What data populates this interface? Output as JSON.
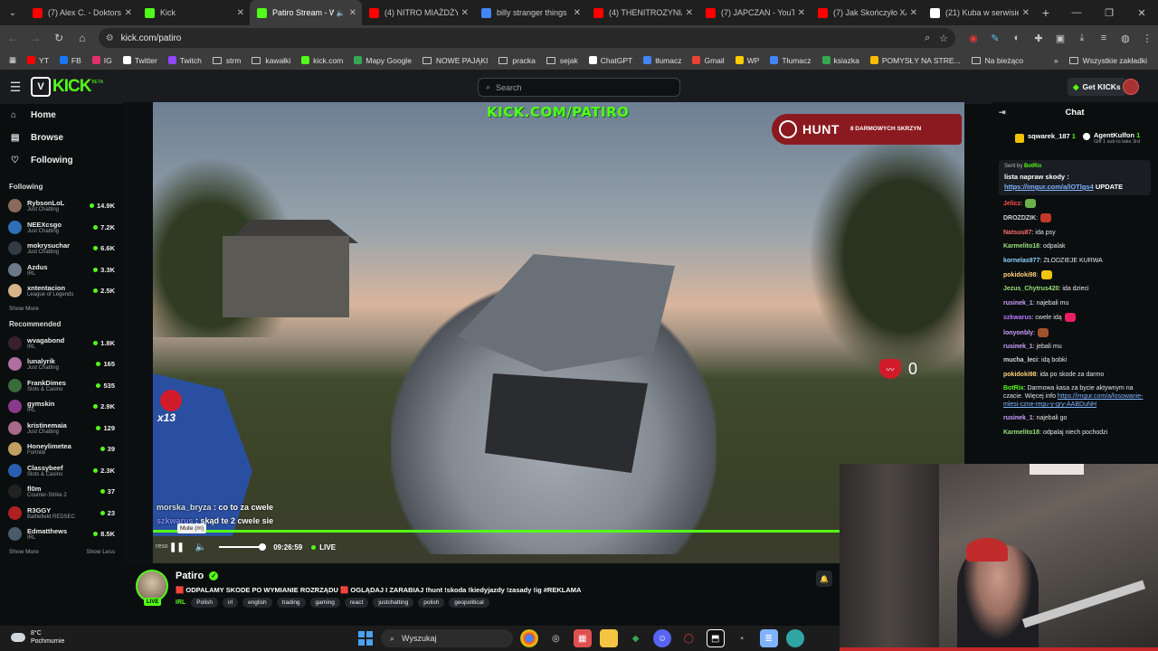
{
  "browser": {
    "tabs": [
      {
        "label": "(7) Alex C. - Doktorsp",
        "favicon_color": "#ff0000",
        "active": false
      },
      {
        "label": "Kick",
        "favicon_color": "#53fc18",
        "active": false
      },
      {
        "label": "Patiro Stream - W",
        "favicon_color": "#53fc18",
        "active": true
      },
      {
        "label": "(4) NITRO MIAŻDŻY",
        "favicon_color": "#ff0000",
        "active": false
      },
      {
        "label": "billy stranger things",
        "favicon_color": "#4285f4",
        "active": false
      },
      {
        "label": "(4) THENITROZYNIAK",
        "favicon_color": "#ff0000",
        "active": false
      },
      {
        "label": "(7) JAPCZAN - YouTu",
        "favicon_color": "#ff0000",
        "active": false
      },
      {
        "label": "(7) Jak Skończyło XA",
        "favicon_color": "#ff0000",
        "active": false
      },
      {
        "label": "(21) Kuba w serwisie",
        "favicon_color": "#ffffff",
        "active": false
      }
    ],
    "url": "kick.com/patiro",
    "bookmarks": [
      {
        "label": "YT",
        "color": "#ff0000"
      },
      {
        "label": "FB",
        "color": "#1877f2"
      },
      {
        "label": "IG",
        "color": "#e1306c"
      },
      {
        "label": "Twitter",
        "color": "#ffffff"
      },
      {
        "label": "Twitch",
        "color": "#9146ff"
      },
      {
        "label": "strm",
        "folder": true
      },
      {
        "label": "kawałki",
        "folder": true
      },
      {
        "label": "kick.com",
        "color": "#53fc18"
      },
      {
        "label": "Mapy Google",
        "color": "#34a853"
      },
      {
        "label": "NOWE PAJĄKI",
        "folder": true
      },
      {
        "label": "pracka",
        "folder": true
      },
      {
        "label": "sejak",
        "folder": true
      },
      {
        "label": "ChatGPT",
        "color": "#ffffff"
      },
      {
        "label": "tłumacz",
        "color": "#4285f4"
      },
      {
        "label": "Gmail",
        "color": "#ea4335"
      },
      {
        "label": "WP",
        "color": "#ffcc00"
      },
      {
        "label": "Tłumacz",
        "color": "#4285f4"
      },
      {
        "label": "ksiazka",
        "color": "#34a853"
      },
      {
        "label": "POMYSŁY NA STRE...",
        "color": "#fbbc05"
      },
      {
        "label": "Na bieżąco",
        "folder": true
      }
    ],
    "bookmarks_other": "Wszystkie zakładki"
  },
  "kick": {
    "logo": "KICK",
    "logo_beta": "BETA",
    "search_placeholder": "Search",
    "get_kicks": "Get KICKs"
  },
  "sidebar": {
    "nav": [
      {
        "label": "Home",
        "icon": "home-icon"
      },
      {
        "label": "Browse",
        "icon": "browse-icon"
      },
      {
        "label": "Following",
        "icon": "heart-icon"
      }
    ],
    "following_header": "Following",
    "following": [
      {
        "name": "RybsonLoL",
        "category": "Just Chatting",
        "viewers": "14.9K",
        "color": "#8a6a5a"
      },
      {
        "name": "NEEXcsgo",
        "category": "Just Chatting",
        "viewers": "7.2K",
        "color": "#2e6fb7"
      },
      {
        "name": "mokrysuchar",
        "category": "Just Chatting",
        "viewers": "6.6K",
        "color": "#333b44"
      },
      {
        "name": "Azdus",
        "category": "IRL",
        "viewers": "3.3K",
        "color": "#6c7a87"
      },
      {
        "name": "xntentacion",
        "category": "League of Legends",
        "viewers": "2.5K",
        "color": "#d8b48a"
      }
    ],
    "show_more": "Show More",
    "recommended_header": "Recommended",
    "recommended": [
      {
        "name": "wvagabond",
        "category": "IRL",
        "viewers": "1.8K",
        "color": "#3b1f2b"
      },
      {
        "name": "lunalyrik",
        "category": "Just Chatting",
        "viewers": "165",
        "color": "#b06fa0"
      },
      {
        "name": "FrankDimes",
        "category": "Slots & Casino",
        "viewers": "535",
        "color": "#3a6b3a"
      },
      {
        "name": "gymskin",
        "category": "IRL",
        "viewers": "2.9K",
        "color": "#8a3a8a"
      },
      {
        "name": "kristinemaia",
        "category": "Just Chatting",
        "viewers": "129",
        "color": "#a86a8a"
      },
      {
        "name": "Honeylimetea",
        "category": "Fortnite",
        "viewers": "39",
        "color": "#c0a060"
      },
      {
        "name": "Classybeef",
        "category": "Slots & Casino",
        "viewers": "2.3K",
        "color": "#2a5fb0"
      },
      {
        "name": "fl0m",
        "category": "Counter-Strike 2",
        "viewers": "37",
        "color": "#222222"
      },
      {
        "name": "R3GGY",
        "category": "Battlefield REDSEC",
        "viewers": "23",
        "color": "#b02020"
      },
      {
        "name": "Edmatthews",
        "category": "IRL",
        "viewers": "8.5K",
        "color": "#4a5a6a"
      }
    ],
    "show_more_2": "Show More",
    "show_less": "Show Less"
  },
  "video": {
    "watermark": "KICK.COM/PATIRO",
    "hunt": "HUNT",
    "hunt_sub": "8 DARMOWYCH SKRZYN",
    "counter": "0",
    "combo": "x13",
    "overlay_chat": [
      {
        "user": "morska_bryza",
        "text": " : co to za cwele"
      },
      {
        "user": "szkwarus",
        "text": " : skąd te 2 cwele sie"
      }
    ],
    "resolution_hint": "reso",
    "tooltip": "Mute (m)",
    "time": "09:26:59",
    "live_label": "LIVE"
  },
  "stream": {
    "channel": "Patiro",
    "live_badge": "LIVE",
    "title": "🟥 ODPALAMY SKODE PO WYMIANIE ROZRZĄDU 🟥 OGLĄDAJ I ZARABIAJ !hunt !skoda !kiedyjazdy !zasady !ig #REKLAMA",
    "language": "IRL",
    "tags": [
      "Polish",
      "irl",
      "english",
      "trading",
      "gaming",
      "react",
      "justchatting",
      "polish",
      "geopolitical"
    ]
  },
  "chat": {
    "title": "Chat",
    "gifters": [
      {
        "name": "sqwarek_187",
        "count": "1",
        "sub": ""
      },
      {
        "name": "AgentKulfon",
        "count": "1",
        "sub": "Gift 1 sub to take 3rd"
      }
    ],
    "pinned": {
      "sent_by": "Sent by",
      "sender": "BotRix",
      "text": "lista napraw skody :",
      "link": "https://imgur.com/a/lOTlgs4",
      "suffix": " UPDATE"
    },
    "messages": [
      {
        "user": "Jelicz",
        "color": "#ff4d4d",
        "text": ":",
        "emote": "#6ab04c"
      },
      {
        "user": "DROZDZIK",
        "color": "#cfd8dc",
        "text": ":",
        "emote": "#c0392b"
      },
      {
        "user": "Natsuu87",
        "color": "#ff6b6b",
        "text": ": ida psy"
      },
      {
        "user": "Karmelito18",
        "color": "#9be07a",
        "text": ": odpalak"
      },
      {
        "user": "kornelas977",
        "color": "#8fd3ff",
        "text": ": ZŁODZIEJE KURWA"
      },
      {
        "user": "pokidoki98",
        "color": "#ffd27a",
        "text": ":",
        "emote": "#f1c40f"
      },
      {
        "user": "Jezus_Chytrus420",
        "color": "#9be07a",
        "text": ": ida dzieci"
      },
      {
        "user": "rusinek_1",
        "color": "#c9a0ff",
        "text": ": najebali mu"
      },
      {
        "user": "szkwarus",
        "color": "#b67bff",
        "text": ": cwele idą",
        "emote": "#e91e63"
      },
      {
        "user": "lonyonbly",
        "color": "#c9a0ff",
        "text": ":",
        "emote": "#a0522d"
      },
      {
        "user": "rusinek_1",
        "color": "#c9a0ff",
        "text": ": jebali mu"
      },
      {
        "user": "mucha_leci",
        "color": "#cfd8dc",
        "text": ": idą bobki"
      },
      {
        "user": "pokidoki98",
        "color": "#ffd27a",
        "text": ": ida po skode za darmo"
      },
      {
        "user": "BotRix",
        "color": "#53fc18",
        "text": ": Darmowa kasa za bycie aktywnym na czacie. Więcej info ",
        "link": "https://imgur.com/a/losowanie-mlesi-czne-regu-y-gry-AABDuNH"
      },
      {
        "user": "rusinek_1",
        "color": "#c9a0ff",
        "text": ": najebali go"
      },
      {
        "user": "Karmelito18",
        "color": "#9be07a",
        "text": ": odpalaj niech pochodzi"
      }
    ]
  },
  "taskbar": {
    "temp": "8°C",
    "weather": "Pochmurnie",
    "search": "Wyszukaj"
  }
}
